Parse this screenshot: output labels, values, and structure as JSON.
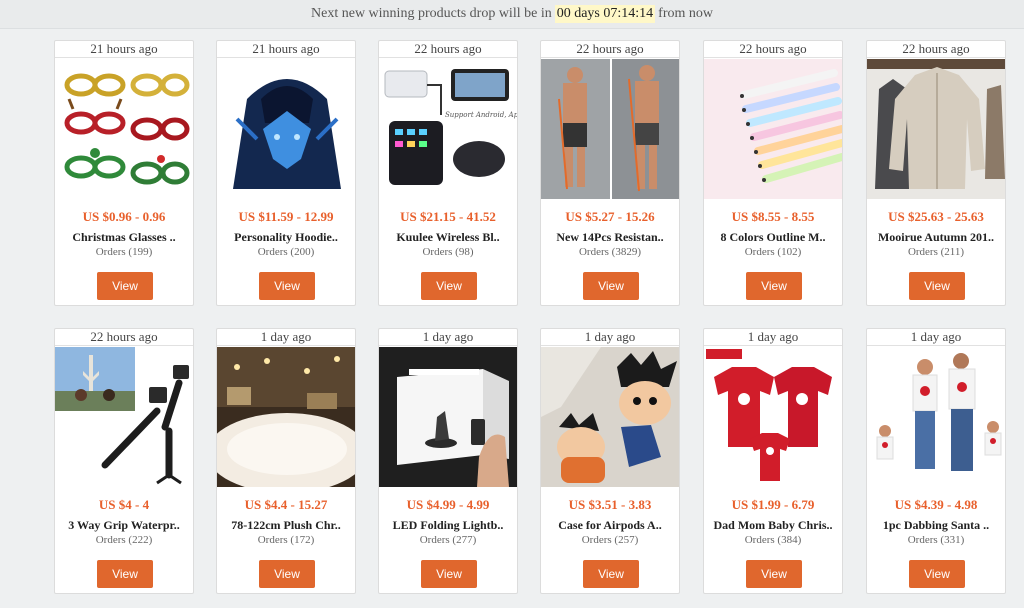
{
  "banner": {
    "prefix": "Next new winning products drop will be in",
    "timer": "00 days 07:14:14",
    "suffix": "from now"
  },
  "view_label": "View",
  "products": [
    {
      "time": "21 hours ago",
      "price": "US $0.96 - 0.96",
      "title": "Christmas Glasses ..",
      "orders": "Orders (199)",
      "image": "christmas-glasses-image"
    },
    {
      "time": "21 hours ago",
      "price": "US $11.59 - 12.99",
      "title": "Personality Hoodie..",
      "orders": "Orders (200)",
      "image": "wolf-hoodie-image"
    },
    {
      "time": "22 hours ago",
      "price": "US $21.15 - 41.52",
      "title": "Kuulee Wireless Bl..",
      "orders": "Orders (98)",
      "image": "gaming-keyboard-image"
    },
    {
      "time": "22 hours ago",
      "price": "US $5.27 - 15.26",
      "title": "New 14Pcs Resistan..",
      "orders": "Orders (3829)",
      "image": "resistance-bands-image"
    },
    {
      "time": "22 hours ago",
      "price": "US $8.55 - 8.55",
      "title": "8 Colors Outline M..",
      "orders": "Orders (102)",
      "image": "markers-image"
    },
    {
      "time": "22 hours ago",
      "price": "US $25.63 - 25.63",
      "title": "Mooirue Autumn 201..",
      "orders": "Orders (211)",
      "image": "cardigan-image"
    },
    {
      "time": "22 hours ago",
      "price": "US $4 - 4",
      "title": "3 Way Grip Waterpr..",
      "orders": "Orders (222)",
      "image": "camera-grip-image"
    },
    {
      "time": "1 day ago",
      "price": "US $4.4 - 15.27",
      "title": "78-122cm Plush Chr..",
      "orders": "Orders (172)",
      "image": "tree-skirt-image"
    },
    {
      "time": "1 day ago",
      "price": "US $4.99 - 4.99",
      "title": "LED Folding Lightb..",
      "orders": "Orders (277)",
      "image": "lightbox-image"
    },
    {
      "time": "1 day ago",
      "price": "US $3.51 - 3.83",
      "title": "Case for Airpods A..",
      "orders": "Orders (257)",
      "image": "airpods-case-image"
    },
    {
      "time": "1 day ago",
      "price": "US $1.99 - 6.79",
      "title": "Dad Mom Baby Chris..",
      "orders": "Orders (384)",
      "image": "family-shirts-image"
    },
    {
      "time": "1 day ago",
      "price": "US $4.39 - 4.98",
      "title": "1pc Dabbing Santa ..",
      "orders": "Orders (331)",
      "image": "dabbing-santa-image"
    }
  ]
}
